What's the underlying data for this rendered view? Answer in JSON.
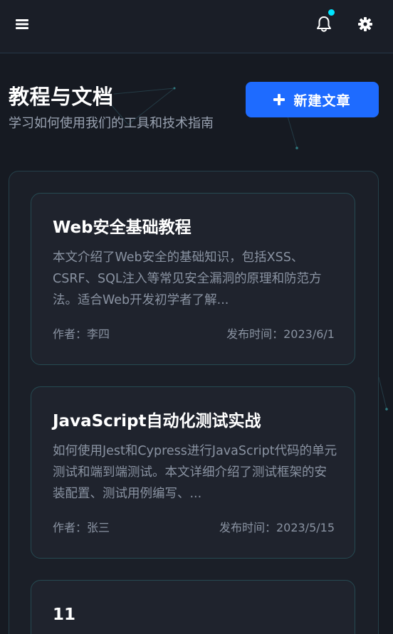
{
  "topbar": {
    "menu_icon": "hamburger-icon",
    "bell_icon": "bell-icon",
    "settings_icon": "gear-icon",
    "notification_dot_color": "#00e5ff"
  },
  "header": {
    "title": "教程与文档",
    "subtitle": "学习如何使用我们的工具和技术指南"
  },
  "new_button": {
    "icon": "plus-icon",
    "label": "新建文章",
    "color": "#1e6bff"
  },
  "articles": [
    {
      "title": "Web安全基础教程",
      "description": "本文介绍了Web安全的基础知识，包括XSS、CSRF、SQL注入等常见安全漏洞的原理和防范方法。适合Web开发初学者了解...",
      "author": "作者：李四",
      "date": "发布时间：2023/6/1"
    },
    {
      "title": "JavaScript自动化测试实战",
      "description": "如何使用Jest和Cypress进行JavaScript代码的单元测试和端到端测试。本文详细介绍了测试框架的安装配置、测试用例编写、...",
      "author": "作者：张三",
      "date": "发布时间：2023/5/15"
    },
    {
      "title": "11"
    }
  ],
  "colors": {
    "background": "#161a22",
    "accent": "#1e6bff",
    "card_border": "#264a52"
  }
}
